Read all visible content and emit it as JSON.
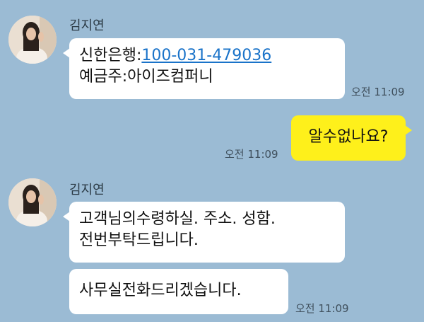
{
  "chat": {
    "background": "#9bbbd4",
    "my_bubble_color": "#fef01b",
    "their_bubble_color": "#ffffff",
    "link_color": "#1a73c9",
    "group1": {
      "sender": "김지연",
      "avatar_icon": "profile-photo-icon",
      "msg1_bank": "신한은행:",
      "msg1_account": "100-031-479036",
      "msg1_line2": "예금주:아이즈컴퍼니",
      "time": "오전 11:09"
    },
    "mine": {
      "text": "알수없나요?",
      "time": "오전 11:09"
    },
    "group2": {
      "sender": "김지연",
      "avatar_icon": "profile-photo-icon",
      "msg1_line1": "고객님의수령하실.  주소. 성함.",
      "msg1_line2": "전번부탁드립니다.",
      "msg2": "사무실전화드리겠습니다.",
      "time": "오전 11:09"
    }
  }
}
